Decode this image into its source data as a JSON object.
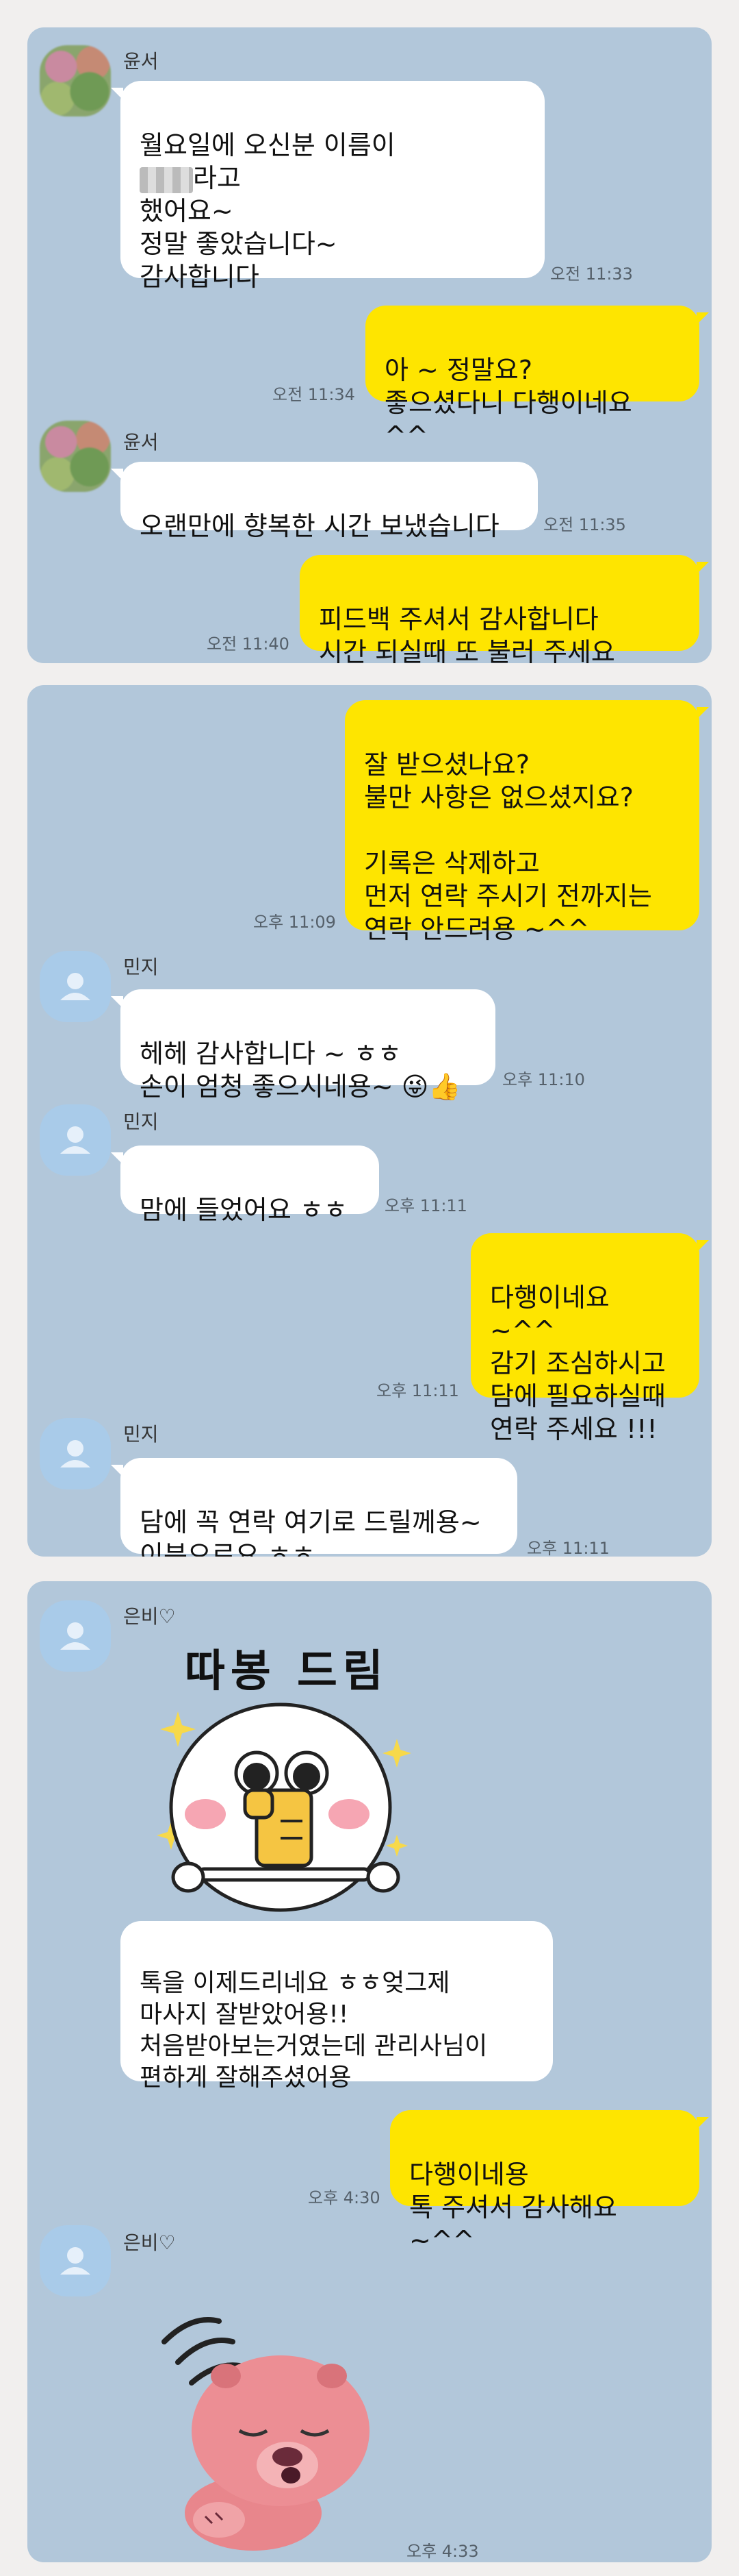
{
  "panel1": {
    "msg1": {
      "sender": "윤서",
      "text_before": "월요일에 오신분 이름이",
      "text_after": "라고",
      "text_rest": "했어요~\n정말 좋았습니다~\n감사합니다",
      "time": "오전 11:33"
    },
    "msg2": {
      "text": "아 ~ 정말요?\n좋으셨다니 다행이네요 ^^",
      "time": "오전 11:34"
    },
    "msg3": {
      "sender": "윤서",
      "text": "오랜만에 향복한 시간 보냈습니다",
      "time": "오전 11:35"
    },
    "msg4": {
      "text": "피드백 주셔서 감사합니다\n시간 되실때 또 불러 주세요 ~^^",
      "time": "오전 11:40"
    }
  },
  "panel2": {
    "msg1": {
      "text": "잘 받으셨나요?\n불만 사항은 없으셨지요?\n\n기록은 삭제하고\n먼저 연락 주시기 전까지는\n연락 안드려용 ~^^",
      "time": "오후 11:09"
    },
    "msg2": {
      "sender": "민지",
      "text": "헤헤 감사합니다 ~ ㅎㅎ\n손이 엄청 좋으시네용~ 😜👍",
      "time": "오후 11:10"
    },
    "msg3": {
      "sender": "민지",
      "text": "맘에 들었어요 ㅎㅎ",
      "time": "오후 11:11"
    },
    "msg4": {
      "text": "다행이네요 ~^^\n감기 조심하시고\n담에 필요하실때\n연락 주세요 !!!",
      "time": "오후 11:11"
    },
    "msg5": {
      "sender": "민지",
      "text": "담에 꼭 연락 여기로 드릴께용~\n이분으로요 ㅎㅎ",
      "time": "오후 11:11"
    }
  },
  "panel3": {
    "msg1": {
      "sender": "은비♡",
      "sticker_text": "따봉 드림"
    },
    "msg2": {
      "text": "톡을 이제드리네요 ㅎㅎ엊그제\n마사지 잘받았어용!!\n처음받아보는거였는데 관리사님이\n편하게 잘해주셨어용"
    },
    "msg3": {
      "text": "다행이네용\n톡 주셔서 감사해요 ~^^",
      "time": "오후 4:30"
    },
    "msg4": {
      "sender": "은비♡",
      "time": "오후 4:33"
    }
  },
  "colors": {
    "chat_bg": "#b2c7da",
    "out_bubble": "#fee500",
    "in_bubble": "#ffffff"
  }
}
